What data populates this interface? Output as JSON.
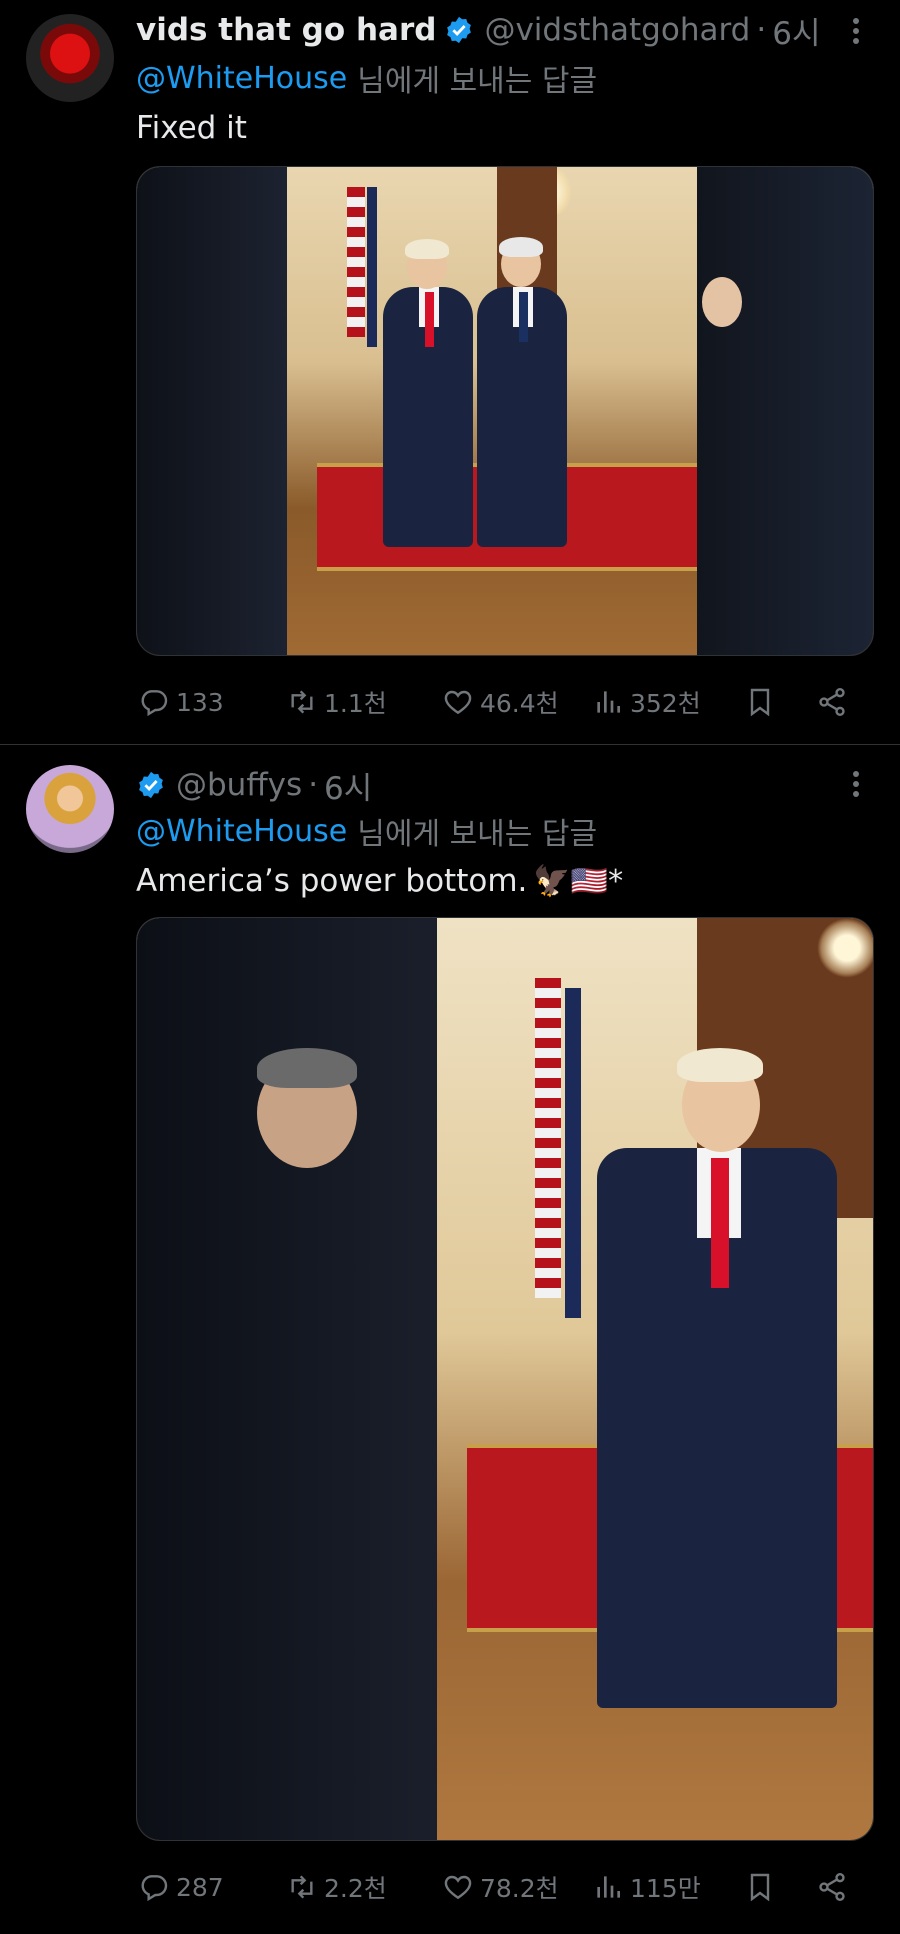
{
  "tweets": [
    {
      "display_name": "vids that go hard",
      "handle": "@vidsthatgohard",
      "time": "6시",
      "reply_to": "@WhiteHouse",
      "reply_suffix": "님에게 보내는 답글",
      "text": "Fixed it",
      "stats": {
        "replies": "133",
        "retweets": "1.1천",
        "likes": "46.4천",
        "views": "352천"
      }
    },
    {
      "display_name": "",
      "handle": "@buffys",
      "time": "6시",
      "reply_to": "@WhiteHouse",
      "reply_suffix": "님에게 보내는 답글",
      "text": "America’s power bottom.",
      "text_emoji": "🦅🇺🇸*",
      "stats": {
        "replies": "287",
        "retweets": "2.2천",
        "likes": "78.2천",
        "views": "115만"
      }
    }
  ],
  "separator": "·",
  "icons": [
    "verified-badge-icon",
    "more-icon",
    "reply-icon",
    "retweet-icon",
    "like-icon",
    "views-icon",
    "bookmark-icon",
    "share-icon"
  ],
  "colors": {
    "background": "#000000",
    "text": "#e7e9ea",
    "muted": "#71767b",
    "accent": "#1d9bf0",
    "divider": "#2f3336"
  }
}
